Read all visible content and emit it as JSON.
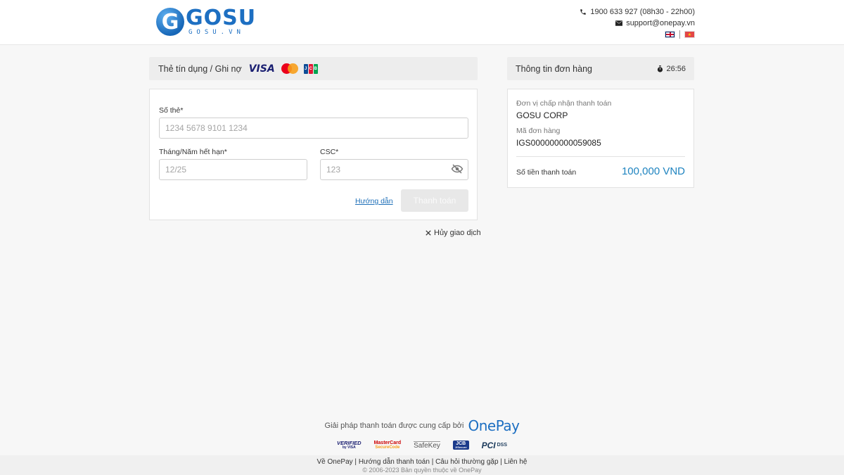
{
  "header": {
    "logo_word": "GOSU",
    "logo_sub": "GOSU.VN",
    "logo_mark": "G",
    "phone": "1900 633 927 (08h30 - 22h00)",
    "email": "support@onepay.vn",
    "icons": {
      "phone": "phone-icon",
      "email": "envelope-icon"
    },
    "languages": [
      "flag-en",
      "flag-vn"
    ]
  },
  "payment": {
    "method_title": "Thẻ tín dụng / Ghi nợ",
    "brands": {
      "visa": "VISA",
      "jcb": [
        "J",
        "C",
        "B"
      ]
    },
    "card_number_label": "Số thẻ*",
    "card_number_placeholder": "1234 5678 9101 1234",
    "expiry_label": "Tháng/Năm hết hạn*",
    "expiry_placeholder": "12/25",
    "csc_label": "CSC*",
    "csc_placeholder": "123",
    "guide_link": "Hướng dẫn",
    "pay_button": "Thanh toán",
    "cancel": "Hủy giao dịch"
  },
  "order": {
    "title": "Thông tin đơn hàng",
    "timer": "26:56",
    "merchant_label": "Đơn vị chấp nhận thanh toán",
    "merchant_value": "GOSU CORP",
    "order_id_label": "Mã đơn hàng",
    "order_id_value": "IGS000000000059085",
    "amount_label": "Số tiền thanh toán",
    "amount_value": "100,000 VND"
  },
  "footer": {
    "provider_text": "Giải pháp thanh toán được cung cấp bởi",
    "provider_brand": "OnePay",
    "badges": {
      "visa_top": "VERIFIED",
      "visa_bottom": "by VISA",
      "mc_top": "MasterCard",
      "mc_bottom": "SecureCode",
      "amex": "SafeKey",
      "jcb_top": "JCB",
      "jcb_bottom": "J/Secure",
      "pci": "PCI",
      "dss": "DSS"
    },
    "links": [
      "Về OnePay",
      "Hướng dẫn thanh toán",
      "Câu hỏi thường gặp",
      "Liên hệ"
    ],
    "copyright": "© 2006-2023 Bản quyền thuộc về OnePay"
  },
  "colors": {
    "accent": "#1d6fc2",
    "amount": "#1f84c0",
    "button_disabled": "#e8e8e8"
  }
}
